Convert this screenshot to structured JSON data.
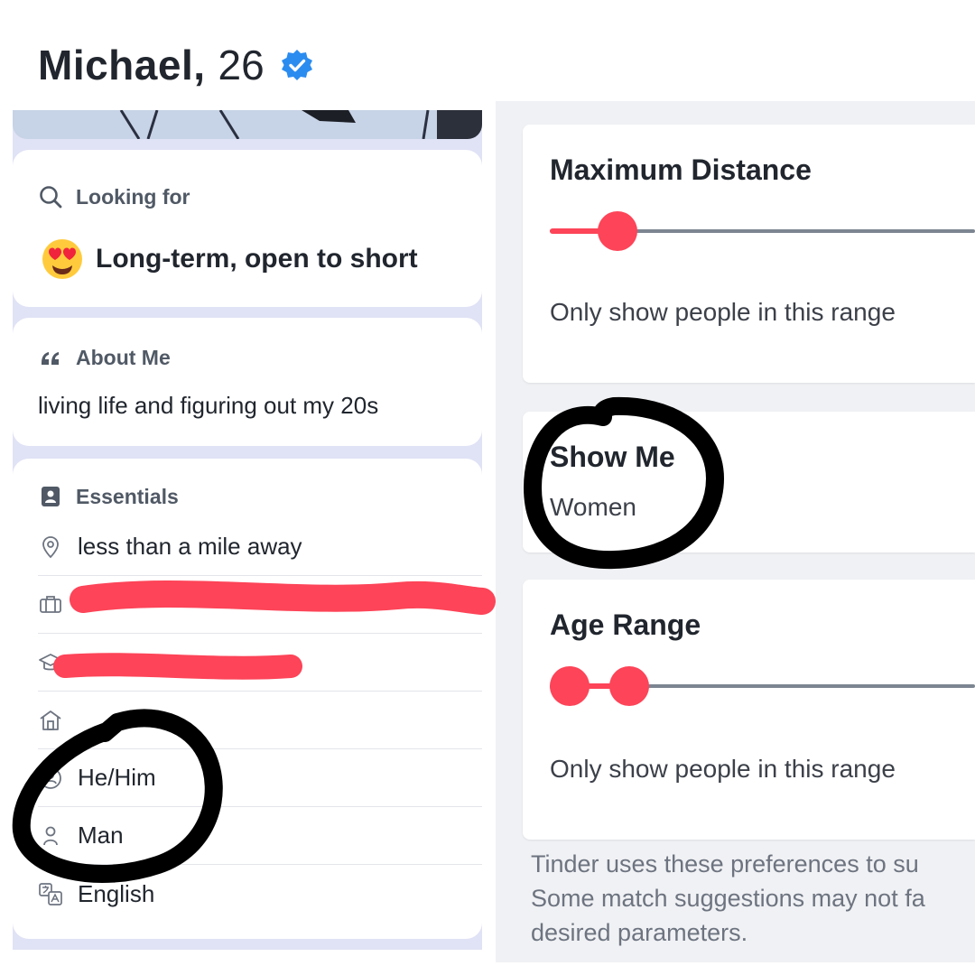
{
  "profile": {
    "name": "Michael,",
    "age": "26",
    "verified_icon": "verified-badge-icon"
  },
  "looking_for": {
    "title": "Looking for",
    "emoji": "heart-eyes-emoji",
    "value": "Long-term, open to short"
  },
  "about": {
    "title": "About Me",
    "text": "living life and figuring out my 20s"
  },
  "essentials": {
    "title": "Essentials",
    "rows": [
      {
        "icon": "location-pin-icon",
        "text": "less than a mile away"
      },
      {
        "icon": "briefcase-icon",
        "text": ""
      },
      {
        "icon": "graduation-cap-icon",
        "text": ""
      },
      {
        "icon": "house-icon",
        "text": ""
      },
      {
        "icon": "pronouns-icon",
        "text": "He/Him"
      },
      {
        "icon": "person-icon",
        "text": "Man"
      },
      {
        "icon": "translate-icon",
        "text": "English"
      }
    ]
  },
  "preferences": {
    "max_distance": {
      "title": "Maximum Distance",
      "subtitle": "Only show people in this range"
    },
    "show_me": {
      "title": "Show Me",
      "value": "Women"
    },
    "age_range": {
      "title": "Age Range",
      "subtitle": "Only show people in this range"
    },
    "footnote": [
      "Tinder uses these preferences to su",
      "Some match suggestions may not fa",
      "desired parameters."
    ]
  },
  "colors": {
    "accent": "#fd4458",
    "verified": "#2b8cf0",
    "annotation": "#000000",
    "redaction": "#fd4458"
  }
}
